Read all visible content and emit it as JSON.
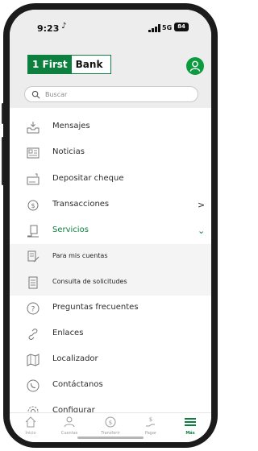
{
  "status_bar": {
    "time": "9:23",
    "network": "5G",
    "battery": "84"
  },
  "header": {
    "logo_number": "1",
    "logo_green": "First",
    "logo_white": "Bank"
  },
  "search": {
    "placeholder": "Buscar"
  },
  "menu": {
    "items": [
      {
        "label": "Mensajes",
        "icon": "inbox-icon"
      },
      {
        "label": "Noticias",
        "icon": "newspaper-icon"
      },
      {
        "label": "Depositar cheque",
        "icon": "check-deposit-icon"
      },
      {
        "label": "Transacciones",
        "icon": "transactions-icon",
        "chevron": ">"
      },
      {
        "label": "Servicios",
        "icon": "services-icon",
        "chevron": "⌄"
      },
      {
        "label": "Para mis cuentas",
        "icon": "document-edit-icon"
      },
      {
        "label": "Consulta de solicitudes",
        "icon": "document-list-icon"
      },
      {
        "label": "Preguntas frecuentes",
        "icon": "question-icon"
      },
      {
        "label": "Enlaces",
        "icon": "link-icon"
      },
      {
        "label": "Localizador",
        "icon": "map-icon"
      },
      {
        "label": "Contáctanos",
        "icon": "phone-icon"
      },
      {
        "label": "Configurar",
        "icon": "gear-icon"
      }
    ]
  },
  "tabbar": {
    "tabs": [
      {
        "label": "Inicio",
        "icon": "home-icon"
      },
      {
        "label": "Cuentas",
        "icon": "accounts-icon"
      },
      {
        "label": "Transferir",
        "icon": "transfer-icon"
      },
      {
        "label": "Pagar",
        "icon": "pay-icon"
      },
      {
        "label": "Más",
        "icon": "menu-icon",
        "active": true
      }
    ]
  },
  "colors": {
    "brand_green": "#0d7f3e",
    "avatar_green": "#0d9b40",
    "header_bg": "#ededed"
  }
}
